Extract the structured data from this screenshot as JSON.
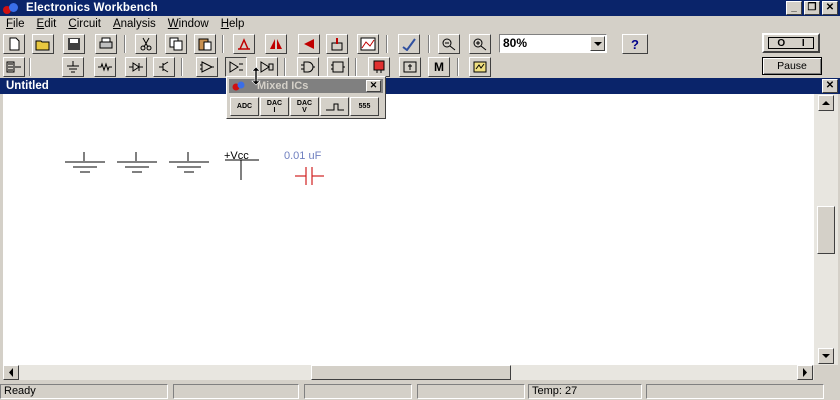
{
  "app": {
    "title": "Electronics Workbench"
  },
  "menu": {
    "items": [
      "File",
      "Edit",
      "Circuit",
      "Analysis",
      "Window",
      "Help"
    ]
  },
  "toolbar": {
    "zoom_value": "80%",
    "help_label": "?"
  },
  "controls": {
    "power_off": "O",
    "power_on": "I",
    "pause_label": "Pause"
  },
  "document": {
    "title": "Untitled"
  },
  "canvas": {
    "vcc_label": "+Vcc",
    "capacitor_label": "0.01 uF"
  },
  "palette": {
    "title": "Mixed ICs",
    "buttons": [
      {
        "line1": "ADC",
        "line2": ""
      },
      {
        "line1": "DAC",
        "line2": "I"
      },
      {
        "line1": "DAC",
        "line2": "V"
      },
      {
        "line1": "",
        "line2": ""
      },
      {
        "line1": "555",
        "line2": ""
      }
    ]
  },
  "status": {
    "text": "Ready",
    "temp": "Temp:  27"
  },
  "colors": {
    "titlebar": "#0a246a",
    "face": "#d4d0c8",
    "capacitor": "#d02020",
    "cap_label": "#7080c0"
  }
}
